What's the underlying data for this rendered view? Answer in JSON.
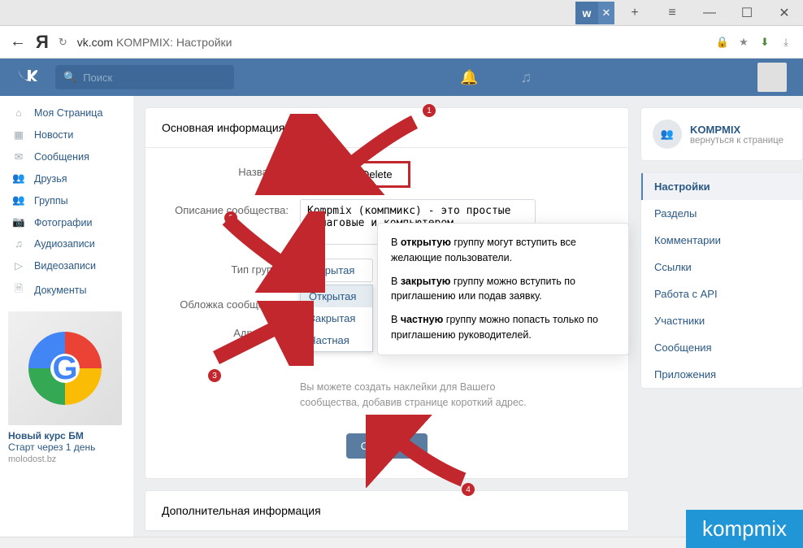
{
  "browser": {
    "tab_icon": "w",
    "url_domain": "vk.com",
    "url_title": "KOMPMIX: Настройки",
    "controls": {
      "plus": "+",
      "menu": "≡",
      "min": "—",
      "max": "☐",
      "close": "✕"
    }
  },
  "vk": {
    "search_placeholder": "Поиск"
  },
  "left_nav": [
    {
      "icon": "⌂",
      "label": "Моя Страница"
    },
    {
      "icon": "▦",
      "label": "Новости"
    },
    {
      "icon": "✉",
      "label": "Сообщения"
    },
    {
      "icon": "👥",
      "label": "Друзья"
    },
    {
      "icon": "👥",
      "label": "Группы"
    },
    {
      "icon": "📷",
      "label": "Фотографии"
    },
    {
      "icon": "♫",
      "label": "Аудиозаписи"
    },
    {
      "icon": "▷",
      "label": "Видеозаписи"
    },
    {
      "icon": "🗎",
      "label": "Документы"
    }
  ],
  "ad": {
    "title": "Новый курс БМ",
    "subtitle": "Старт через 1 день",
    "source": "molodost.bz"
  },
  "main": {
    "section_title": "Основная информация",
    "labels": {
      "name": "Название:",
      "desc": "Описание сообщества:",
      "type": "Тип группы:",
      "cover": "Обложка сообщества:",
      "address": "Адрес стра"
    },
    "name_value": "KOMPMIX Delete",
    "desc_value": "Kompmix (компмикс) - это простые пошаговые и компьютером",
    "type_value": "Открытая",
    "type_options": [
      "Открытая",
      "Закрытая",
      "Частная"
    ],
    "address_prefix": "/",
    "hint": "Вы можете создать наклейки для Вашего сообщества, добавив странице короткий адрес.",
    "save": "Сохранить",
    "section2_title": "Дополнительная информация"
  },
  "tooltip": {
    "p1a": "В ",
    "p1b": "открытую",
    "p1c": " группу могут вступить все желающие пользователи.",
    "p2a": "В ",
    "p2b": "закрытую",
    "p2c": " группу можно вступить по приглашению или подав заявку.",
    "p3a": "В ",
    "p3b": "частную",
    "p3c": " группу можно попасть только по приглашению руководителей."
  },
  "right": {
    "group_name": "KOMPMIX",
    "back": "вернуться к странице",
    "nav": [
      "Настройки",
      "Разделы",
      "Комментарии",
      "Ссылки",
      "Работа с API",
      "Участники",
      "Сообщения",
      "Приложения"
    ]
  },
  "annotations": {
    "n1": "1",
    "n2": "2",
    "n3": "3",
    "n4": "4"
  },
  "watermark": "kompmix"
}
